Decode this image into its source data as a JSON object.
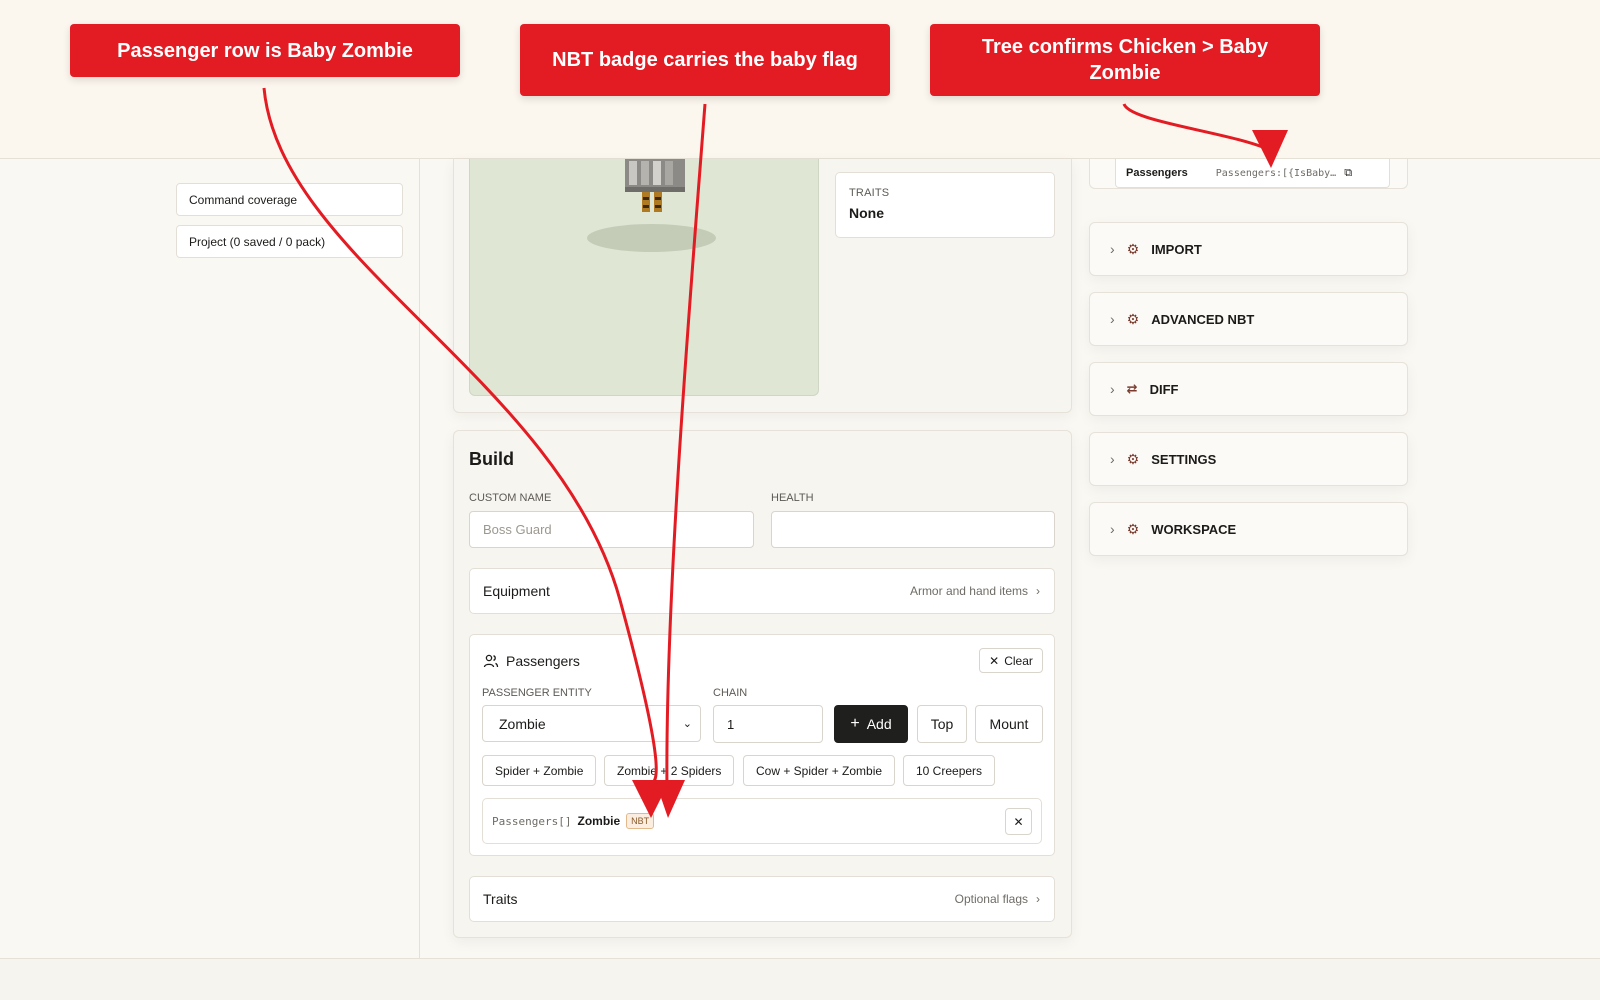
{
  "sidebar": {
    "items": [
      {
        "label": "Command coverage"
      },
      {
        "label": "Project (0 saved / 0 pack)"
      }
    ]
  },
  "preview": {
    "traits_label": "TRAITS",
    "traits_value": "None"
  },
  "build": {
    "title": "Build",
    "custom_name_label": "CUSTOM NAME",
    "custom_name_placeholder": "Boss Guard",
    "health_label": "HEALTH",
    "health_value": "",
    "equipment": {
      "title": "Equipment",
      "hint": "Armor and hand items"
    },
    "passengers": {
      "title": "Passengers",
      "clear_label": "Clear",
      "entity_label": "PASSENGER ENTITY",
      "entity_selected": "Zombie",
      "chain_label": "CHAIN",
      "chain_value": "1",
      "add_label": "Add",
      "top_label": "Top",
      "mount_label": "Mount",
      "presets": [
        "Spider + Zombie",
        "Zombie + 2 Spiders",
        "Cow + Spider + Zombie",
        "10 Creepers"
      ],
      "row": {
        "path": "Passengers[]",
        "entity": "Zombie",
        "badge": "NBT"
      }
    },
    "traits": {
      "title": "Traits",
      "hint": "Optional flags"
    }
  },
  "right_panel": {
    "tree_row": {
      "key": "Passengers",
      "value": "Passengers:[{IsBaby…"
    },
    "sections": [
      "IMPORT",
      "ADVANCED NBT",
      "DIFF",
      "SETTINGS",
      "WORKSPACE"
    ]
  },
  "annotations": [
    {
      "text": "Passenger row is Baby Zombie"
    },
    {
      "text": "NBT badge carries the baby flag"
    },
    {
      "text": "Tree confirms Chicken > Baby Zombie"
    }
  ],
  "colors": {
    "callout": "#e31b23",
    "dark_button": "#1f1f1d",
    "preview_bg": "#dfe6d4"
  }
}
